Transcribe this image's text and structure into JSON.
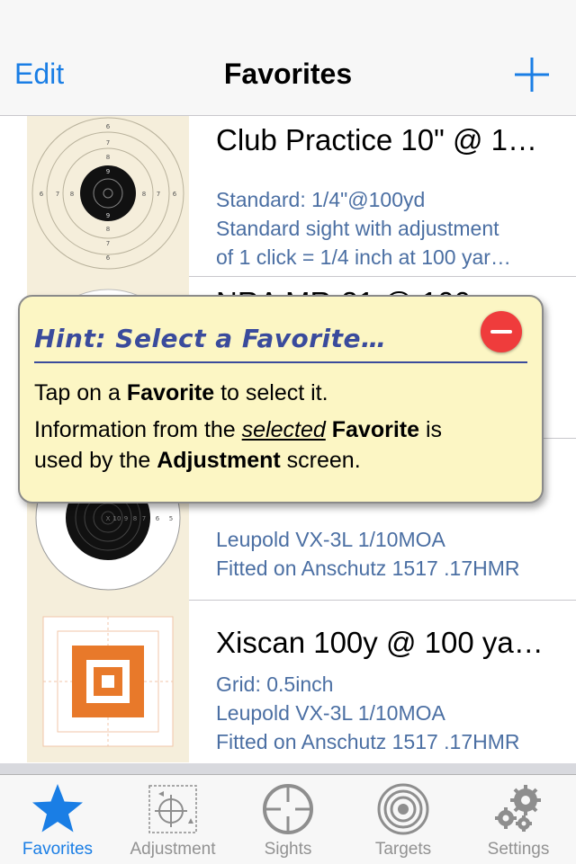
{
  "navbar": {
    "edit_label": "Edit",
    "title": "Favorites",
    "add_icon": "plus-icon"
  },
  "favorites": [
    {
      "title": "Club Practice 10\" @ 1…",
      "lines": [
        "Standard: 1/4\"@100yd",
        "Standard sight with adjustment",
        "of 1 click = 1/4 inch at 100 yar…"
      ]
    },
    {
      "title": "NRA MR-31 @ 100…",
      "lines": [
        "",
        "",
        ""
      ]
    },
    {
      "title": "",
      "lines": [
        "",
        "Leupold VX-3L 1/10MOA",
        "Fitted on Anschutz 1517 .17HMR"
      ]
    },
    {
      "title": "Xiscan 100y @ 100 ya…",
      "lines": [
        "Grid: 0.5inch",
        "Leupold VX-3L 1/10MOA",
        "Fitted on Anschutz 1517 .17HMR"
      ]
    }
  ],
  "target1_ring_numbers": [
    "6",
    "7",
    "8",
    "9",
    "9",
    "8",
    "7",
    "6",
    "6",
    "7",
    "8",
    "8",
    "7",
    "6"
  ],
  "target3_ring_numbers": [
    "X",
    "10",
    "9",
    "8",
    "7",
    "6",
    "5"
  ],
  "hint": {
    "title": "Hint: Select a Favorite…",
    "p1_a": "Tap on a ",
    "p1_b": "Favorite",
    "p1_c": " to select it.",
    "p2_a": "Information from the ",
    "p2_b": "selected",
    "p2_c": " ",
    "p2_d": "Favorite",
    "p2_e": " is",
    "p3_a": "used by the ",
    "p3_b": "Adjustment",
    "p3_c": " screen."
  },
  "tabs": [
    {
      "label": "Favorites",
      "icon": "star-icon",
      "active": true
    },
    {
      "label": "Adjustment",
      "icon": "adjustment-icon",
      "active": false
    },
    {
      "label": "Sights",
      "icon": "crosshair-icon",
      "active": false
    },
    {
      "label": "Targets",
      "icon": "target-icon",
      "active": false
    },
    {
      "label": "Settings",
      "icon": "gears-icon",
      "active": false
    }
  ],
  "colors": {
    "accent": "#1a7ee5",
    "hint_bg": "#fcf6c4",
    "hint_title": "#3a4b9c",
    "close": "#ef3c3c",
    "detail": "#4b6fa3",
    "target_orange": "#e8792a"
  }
}
